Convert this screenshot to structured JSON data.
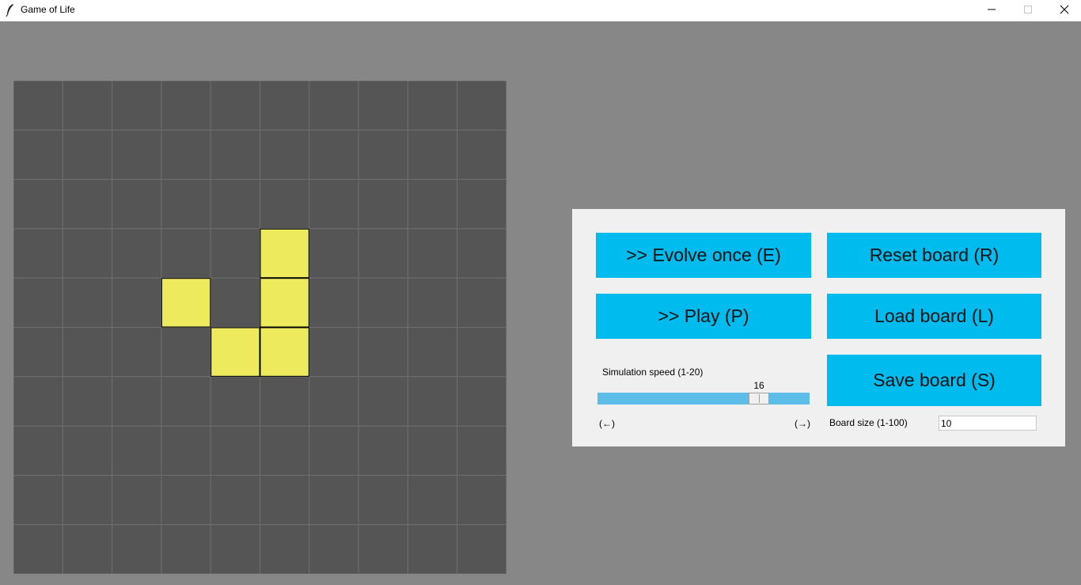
{
  "window": {
    "title": "Game of Life",
    "app_icon": "feather-icon",
    "controls": [
      "minimize-icon",
      "maximize-icon",
      "close-icon"
    ]
  },
  "board": {
    "rows": 10,
    "cols": 10,
    "alive_cells": [
      [
        3,
        5
      ],
      [
        4,
        3
      ],
      [
        4,
        5
      ],
      [
        5,
        4
      ],
      [
        5,
        5
      ]
    ],
    "colors": {
      "dead": "#555555",
      "alive": "#eeea5e",
      "grid": "#6e6e6e",
      "alive_border": "#000000"
    }
  },
  "controls": {
    "evolve_label": ">> Evolve once (E)",
    "reset_label": "Reset board (R)",
    "play_label": ">> Play (P)",
    "load_label": "Load board (L)",
    "save_label": "Save board (S)",
    "speed": {
      "label": "Simulation speed (1-20)",
      "min": 1,
      "max": 20,
      "value": 16,
      "value_text": "16",
      "left_hint": "(←)",
      "right_hint": "(→)"
    },
    "board_size": {
      "label": "Board size (1-100)",
      "value": "10"
    },
    "accent_color": "#00bbee"
  }
}
